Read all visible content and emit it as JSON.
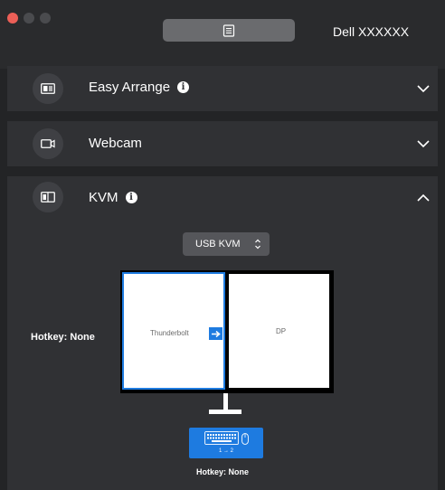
{
  "titlebar": {
    "menu_icon": "document-list-icon",
    "device_name": "Dell XXXXXX"
  },
  "sections": [
    {
      "title": "Easy Arrange",
      "has_info": true,
      "icon": "easy-arrange-icon",
      "expanded": false
    },
    {
      "title": "Webcam",
      "has_info": false,
      "icon": "webcam-icon",
      "expanded": false
    },
    {
      "title": "KVM",
      "has_info": true,
      "icon": "kvm-icon",
      "expanded": true
    }
  ],
  "kvm": {
    "mode_select": {
      "value": "USB KVM"
    },
    "hotkey_left": "Hotkey: None",
    "screens": {
      "left_label": "Thunderbolt",
      "right_label": "DP"
    },
    "device_label": "1 → 2",
    "hotkey_bottom": "Hotkey: None"
  },
  "info_glyph": "i",
  "colors": {
    "background": "#232426",
    "panel": "#303134",
    "accent": "#1e7be0",
    "close": "#ec5f57"
  }
}
